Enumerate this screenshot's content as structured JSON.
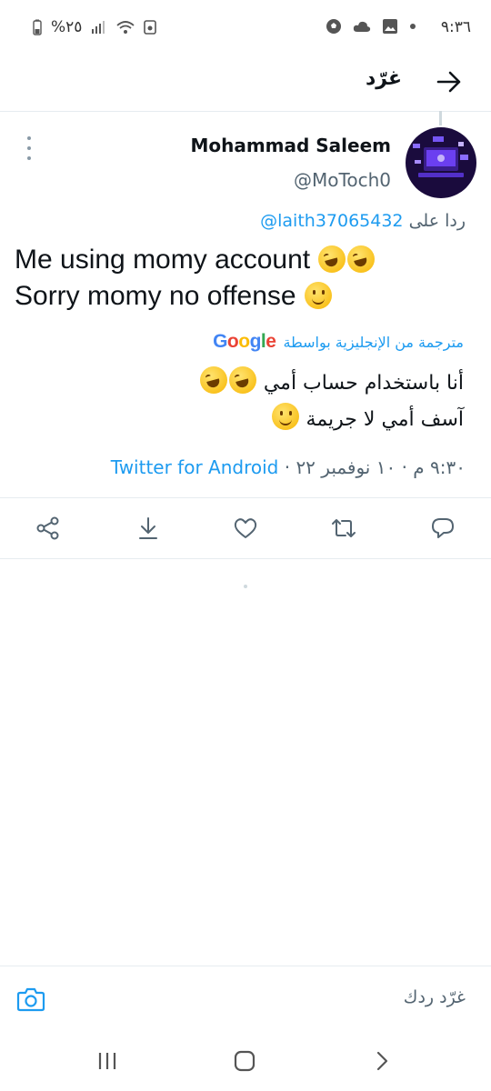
{
  "status_bar": {
    "time": "٩:٣٦",
    "battery_text": "%٢٥",
    "icons_right": [
      "dot-icon",
      "image-icon",
      "cloud-icon",
      "soccer-ball-icon"
    ],
    "icons_left": [
      "battery-icon",
      "signal-icon",
      "wifi-icon",
      "save-icon"
    ]
  },
  "header": {
    "title": "غرّد",
    "back_icon": "arrow-right-icon"
  },
  "tweet": {
    "author_name": "Mohammad Saleem",
    "author_handle": "@MoToch0",
    "reply_prefix": "ردا على",
    "reply_mention": "@laith37065432",
    "text_line1": "Me  using momy account",
    "text_line2": "Sorry momy no offense",
    "translated_by_label": "مترجمة من الإنجليزية بواسطة",
    "translation_provider": "Google",
    "translation_line1": "أنا باستخدام حساب أمي",
    "translation_line2": "آسف أمي لا جريمة",
    "timestamp": "٩:٣٠ م · ١٠ نوفمبر ٢٢ · ",
    "source": "Twitter for Android"
  },
  "actions": [
    "share-icon",
    "bookmark-download-icon",
    "like-heart-icon",
    "retweet-icon",
    "reply-icon"
  ],
  "composer": {
    "placeholder": "غرّد ردك"
  },
  "navbar": {
    "icons": [
      "recent-apps-icon",
      "home-icon",
      "back-icon"
    ]
  },
  "colors": {
    "accent": "#1d9bf0",
    "text_primary": "#0f1419",
    "text_secondary": "#536471",
    "divider": "#e6ecf0"
  }
}
